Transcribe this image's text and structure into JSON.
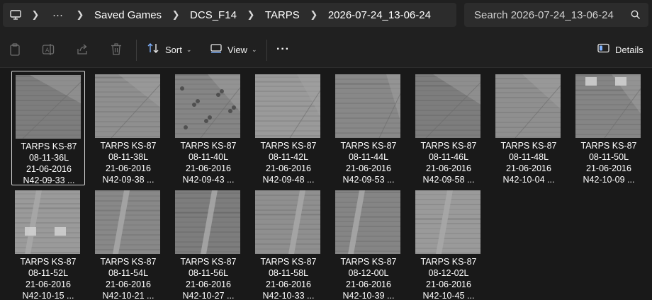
{
  "address": {
    "crumbs": [
      "Saved Games",
      "DCS_F14",
      "TARPS",
      "2026-07-24_13-06-24"
    ],
    "overflow_label": "···"
  },
  "search": {
    "placeholder": "Search 2026-07-24_13-06-24"
  },
  "toolbar": {
    "sort_label": "Sort",
    "view_label": "View",
    "more_label": "···",
    "details_label": "Details"
  },
  "files": [
    {
      "l1": "TARPS KS-87",
      "l2": "08-11-36L",
      "l3": "21-06-2016",
      "l4": "N42-09-33 ...",
      "selected": true,
      "variant": 0
    },
    {
      "l1": "TARPS KS-87",
      "l2": "08-11-38L",
      "l3": "21-06-2016",
      "l4": "N42-09-38 ...",
      "variant": 1
    },
    {
      "l1": "TARPS KS-87",
      "l2": "08-11-40L",
      "l3": "21-06-2016",
      "l4": "N42-09-43 ...",
      "variant": 2
    },
    {
      "l1": "TARPS KS-87",
      "l2": "08-11-42L",
      "l3": "21-06-2016",
      "l4": "N42-09-48 ...",
      "variant": 3
    },
    {
      "l1": "TARPS KS-87",
      "l2": "08-11-44L",
      "l3": "21-06-2016",
      "l4": "N42-09-53 ...",
      "variant": 4
    },
    {
      "l1": "TARPS KS-87",
      "l2": "08-11-46L",
      "l3": "21-06-2016",
      "l4": "N42-09-58 ...",
      "variant": 5
    },
    {
      "l1": "TARPS KS-87",
      "l2": "08-11-48L",
      "l3": "21-06-2016",
      "l4": "N42-10-04 ...",
      "variant": 6
    },
    {
      "l1": "TARPS KS-87",
      "l2": "08-11-50L",
      "l3": "21-06-2016",
      "l4": "N42-10-09 ...",
      "variant": 7
    },
    {
      "l1": "TARPS KS-87",
      "l2": "08-11-52L",
      "l3": "21-06-2016",
      "l4": "N42-10-15 ...",
      "variant": 8
    },
    {
      "l1": "TARPS KS-87",
      "l2": "08-11-54L",
      "l3": "21-06-2016",
      "l4": "N42-10-21 ...",
      "variant": 9
    },
    {
      "l1": "TARPS KS-87",
      "l2": "08-11-56L",
      "l3": "21-06-2016",
      "l4": "N42-10-27 ...",
      "variant": 10
    },
    {
      "l1": "TARPS KS-87",
      "l2": "08-11-58L",
      "l3": "21-06-2016",
      "l4": "N42-10-33 ...",
      "variant": 11
    },
    {
      "l1": "TARPS KS-87",
      "l2": "08-12-00L",
      "l3": "21-06-2016",
      "l4": "N42-10-39 ...",
      "variant": 12
    },
    {
      "l1": "TARPS KS-87",
      "l2": "08-12-02L",
      "l3": "21-06-2016",
      "l4": "N42-10-45 ...",
      "variant": 13
    }
  ],
  "colors": {
    "background": "#191919",
    "bar": "#202020",
    "field": "#2c2c2c",
    "selection": "#d7d7d7"
  }
}
